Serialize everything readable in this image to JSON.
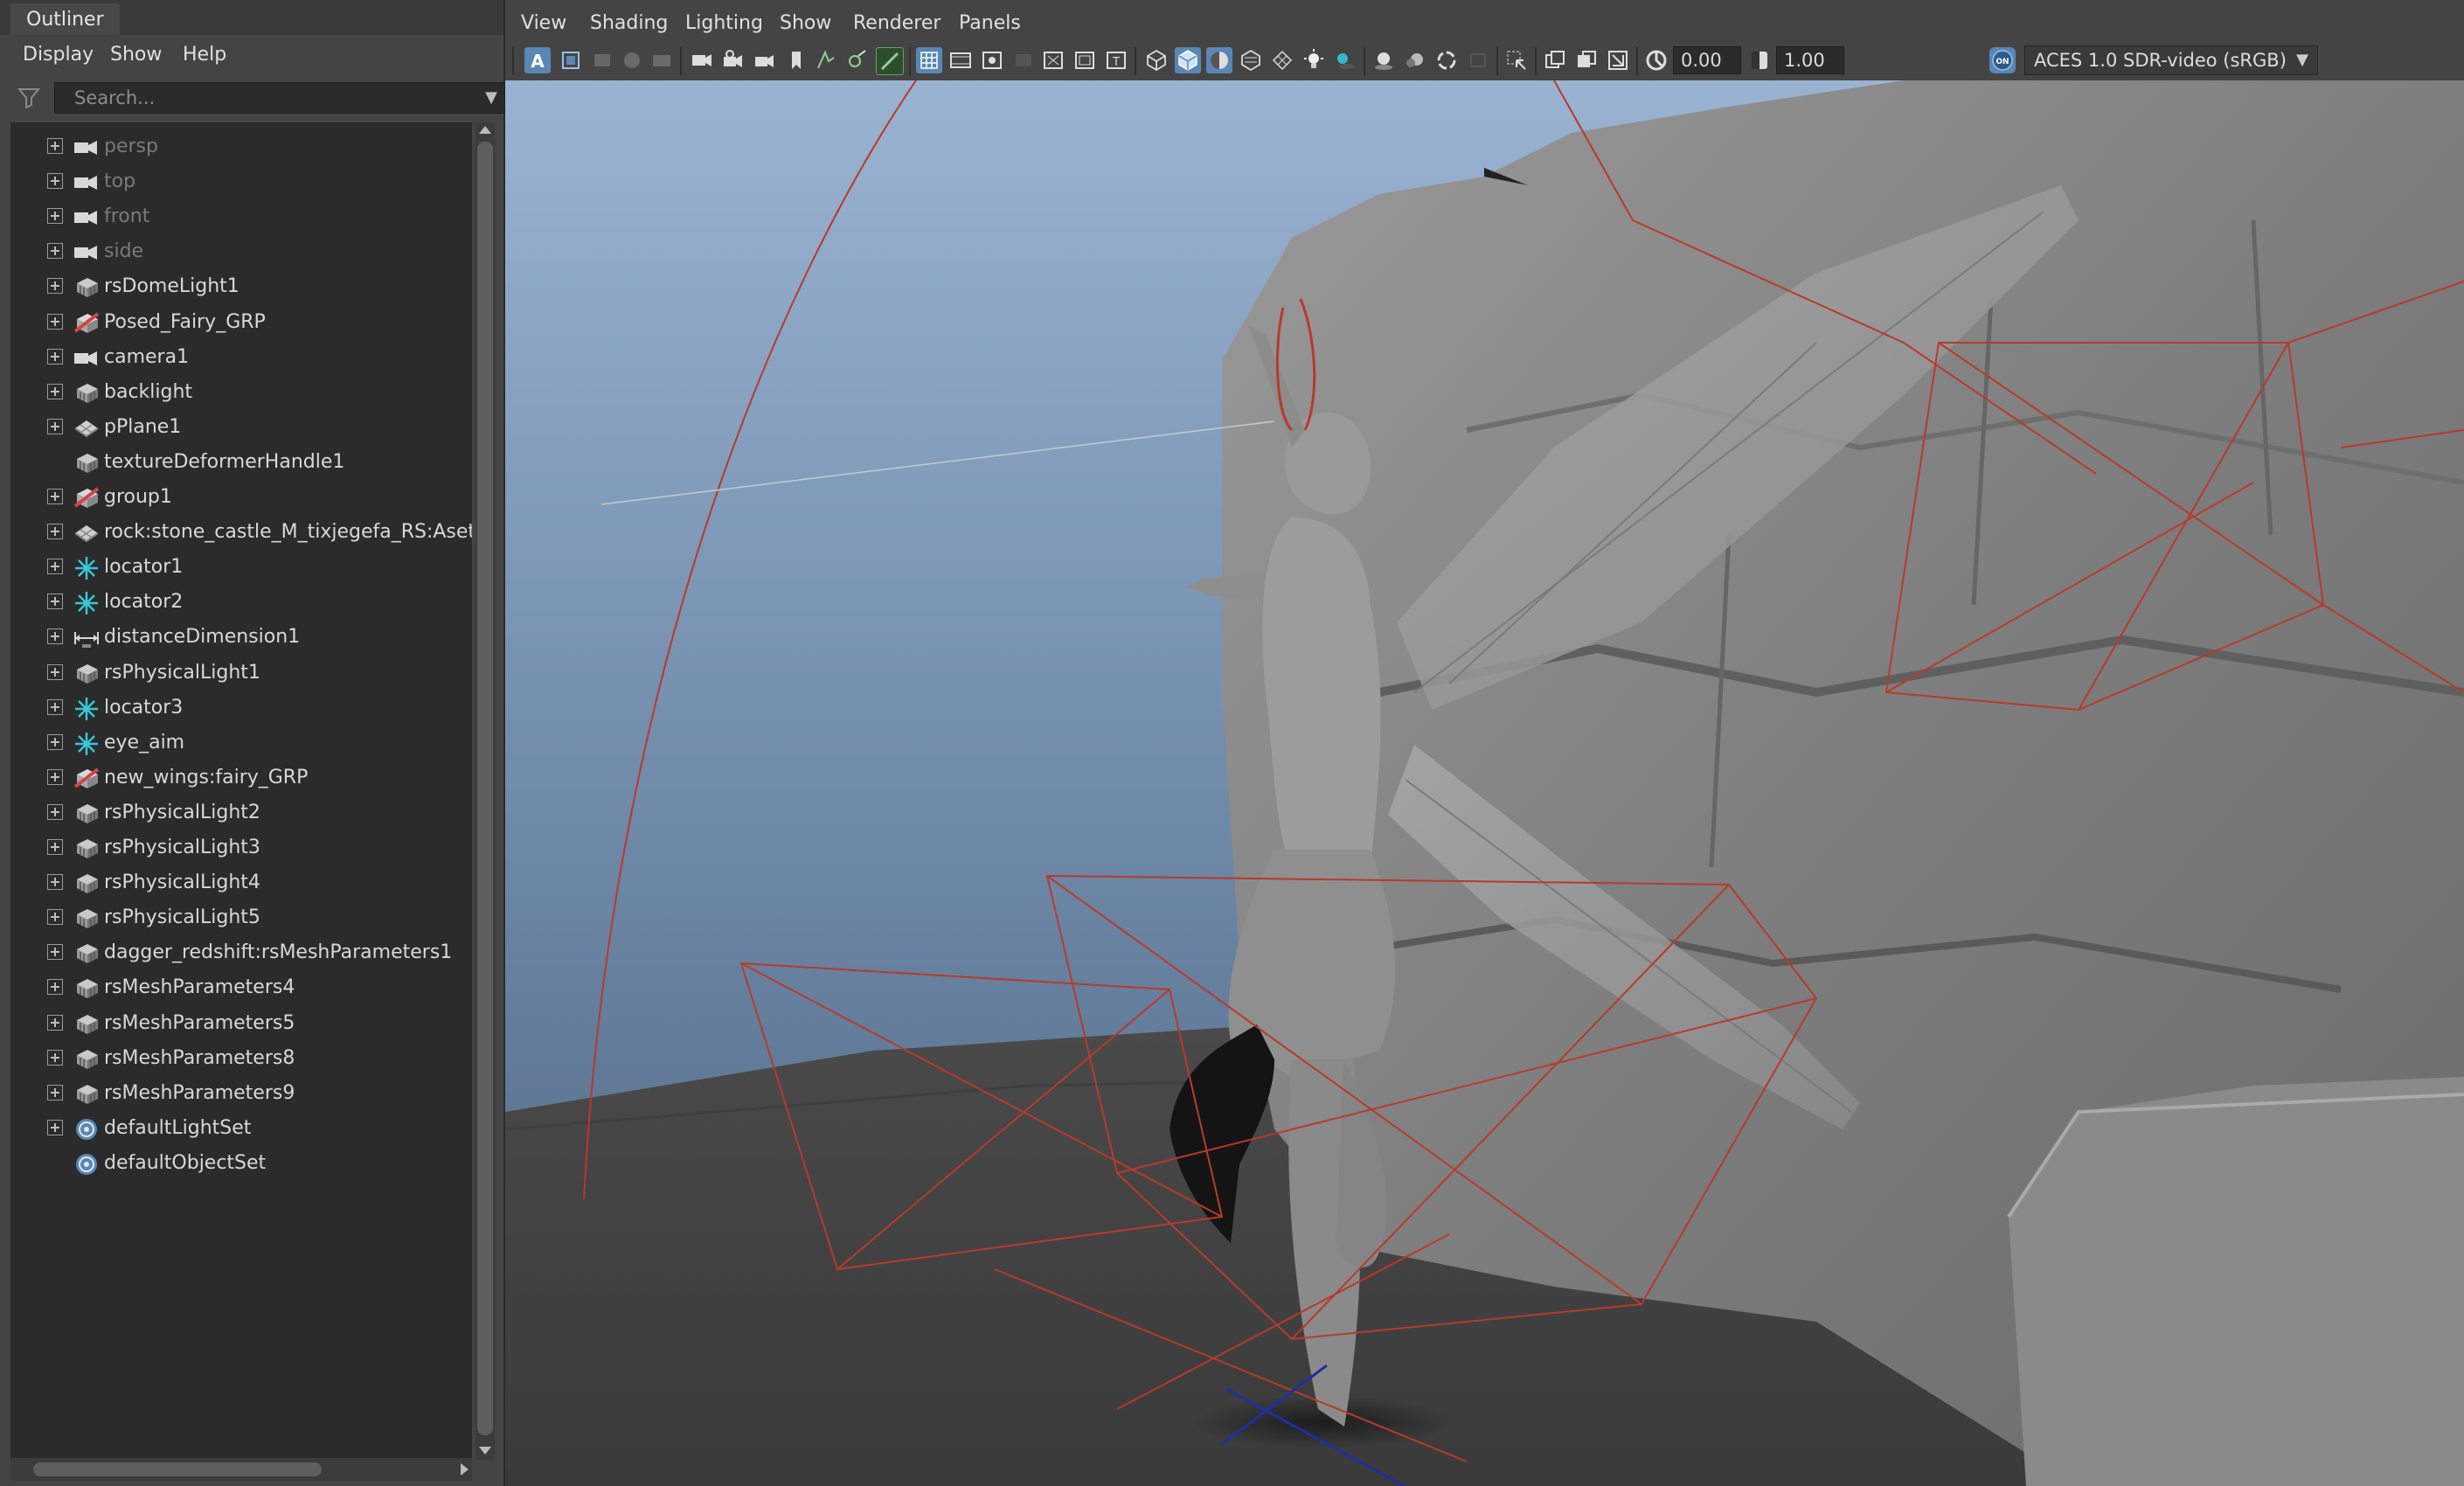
{
  "outliner": {
    "tab_title": "Outliner",
    "menu": [
      "Display",
      "Show",
      "Help"
    ],
    "search_placeholder": "Search...",
    "items": [
      {
        "label": "persp",
        "icon": "camera-icon",
        "dim": true,
        "expandable": true
      },
      {
        "label": "top",
        "icon": "camera-icon",
        "dim": true,
        "expandable": true
      },
      {
        "label": "front",
        "icon": "camera-icon",
        "dim": true,
        "expandable": true
      },
      {
        "label": "side",
        "icon": "camera-icon",
        "dim": true,
        "expandable": true
      },
      {
        "label": "rsDomeLight1",
        "icon": "light-icon",
        "dim": false,
        "expandable": true
      },
      {
        "label": "Posed_Fairy_GRP",
        "icon": "group-icon",
        "dim": false,
        "expandable": true
      },
      {
        "label": "camera1",
        "icon": "camera-icon",
        "dim": false,
        "expandable": true
      },
      {
        "label": "backlight",
        "icon": "light-icon",
        "dim": false,
        "expandable": true
      },
      {
        "label": "pPlane1",
        "icon": "mesh-icon",
        "dim": false,
        "expandable": true
      },
      {
        "label": "textureDeformerHandle1",
        "icon": "light-icon",
        "dim": false,
        "expandable": false
      },
      {
        "label": "group1",
        "icon": "group-icon",
        "dim": false,
        "expandable": true
      },
      {
        "label": "rock:stone_castle_M_tixjegefa_RS:Aset_stone",
        "icon": "mesh-icon",
        "dim": false,
        "expandable": true
      },
      {
        "label": "locator1",
        "icon": "locator-icon",
        "dim": false,
        "expandable": true
      },
      {
        "label": "locator2",
        "icon": "locator-icon",
        "dim": false,
        "expandable": true
      },
      {
        "label": "distanceDimension1",
        "icon": "distance-icon",
        "dim": false,
        "expandable": true
      },
      {
        "label": "rsPhysicalLight1",
        "icon": "light-icon",
        "dim": false,
        "expandable": true
      },
      {
        "label": "locator3",
        "icon": "locator-icon",
        "dim": false,
        "expandable": true
      },
      {
        "label": "eye_aim",
        "icon": "locator-icon",
        "dim": false,
        "expandable": true
      },
      {
        "label": "new_wings:fairy_GRP",
        "icon": "group-icon",
        "dim": false,
        "expandable": true
      },
      {
        "label": "rsPhysicalLight2",
        "icon": "light-icon",
        "dim": false,
        "expandable": true
      },
      {
        "label": "rsPhysicalLight3",
        "icon": "light-icon",
        "dim": false,
        "expandable": true
      },
      {
        "label": "rsPhysicalLight4",
        "icon": "light-icon",
        "dim": false,
        "expandable": true
      },
      {
        "label": "rsPhysicalLight5",
        "icon": "light-icon",
        "dim": false,
        "expandable": true
      },
      {
        "label": "dagger_redshift:rsMeshParameters1",
        "icon": "light-icon",
        "dim": false,
        "expandable": true
      },
      {
        "label": "rsMeshParameters4",
        "icon": "light-icon",
        "dim": false,
        "expandable": true
      },
      {
        "label": "rsMeshParameters5",
        "icon": "light-icon",
        "dim": false,
        "expandable": true
      },
      {
        "label": "rsMeshParameters8",
        "icon": "light-icon",
        "dim": false,
        "expandable": true
      },
      {
        "label": "rsMeshParameters9",
        "icon": "light-icon",
        "dim": false,
        "expandable": true
      },
      {
        "label": "defaultLightSet",
        "icon": "set-icon",
        "dim": false,
        "expandable": true
      },
      {
        "label": "defaultObjectSet",
        "icon": "set-icon",
        "dim": false,
        "expandable": false
      }
    ]
  },
  "viewport": {
    "menu": [
      "View",
      "Shading",
      "Lighting",
      "Show",
      "Renderer",
      "Panels"
    ],
    "exposure_value": "0.00",
    "gamma_value": "1.00",
    "color_space": "ACES 1.0 SDR-video (sRGB)",
    "color_management_badge": "ON"
  },
  "colors": {
    "accent_blue": "#5a86b5",
    "locator_cyan": "#39c6d6",
    "group_red": "#d04646",
    "light_wire": "#b83a2a"
  }
}
